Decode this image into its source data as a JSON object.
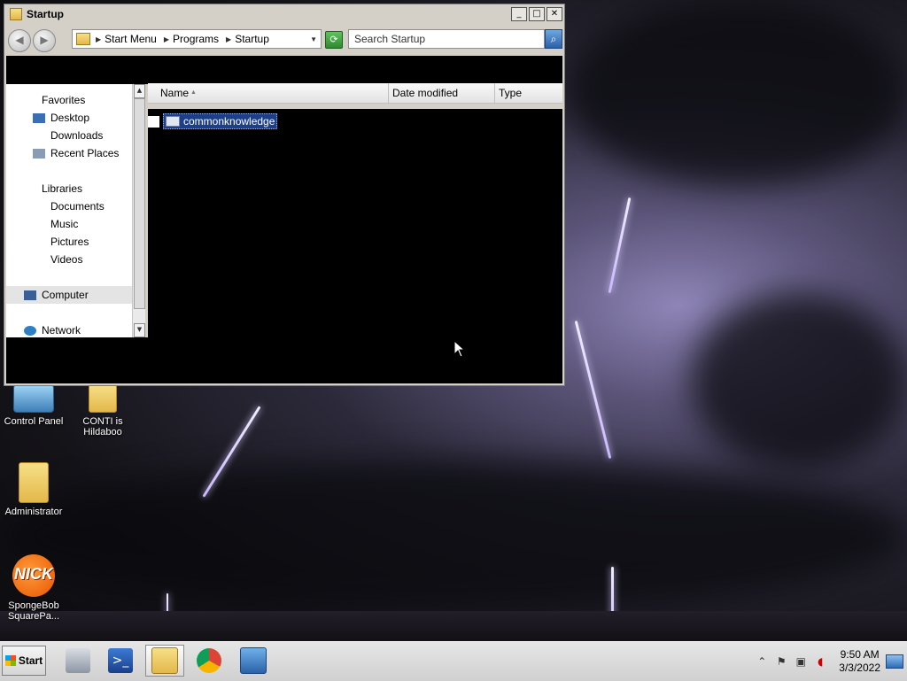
{
  "window": {
    "title": "Startup",
    "controls": {
      "minimize": "_",
      "maximize": "□",
      "close": "✕"
    }
  },
  "address": {
    "breadcrumbs": [
      "Start Menu",
      "Programs",
      "Startup"
    ],
    "search_placeholder": "Search Startup"
  },
  "nav_pane": {
    "favorites_header": "Favorites",
    "favorites": [
      "Desktop",
      "Downloads",
      "Recent Places"
    ],
    "libraries_header": "Libraries",
    "libraries": [
      "Documents",
      "Music",
      "Pictures",
      "Videos"
    ],
    "computer": "Computer",
    "network": "Network"
  },
  "columns": {
    "name": "Name",
    "date": "Date modified",
    "type": "Type"
  },
  "files": [
    {
      "name": "commonknowledge"
    }
  ],
  "desktop_icons": {
    "control_panel": "Control Panel",
    "conti": "CONTI is Hildaboo",
    "administrator": "Administrator",
    "nick_line1": "SpongeBob",
    "nick_line2": "SquarePa...",
    "nick_logo": "NICK"
  },
  "taskbar": {
    "start_label": "Start",
    "clock_time": "9:50 AM",
    "clock_date": "3/3/2022"
  },
  "icons": [
    "folder-icon",
    "back-icon",
    "forward-icon",
    "refresh-icon",
    "search-icon",
    "desktop-icon",
    "downloads-icon",
    "recent-places-icon",
    "computer-icon",
    "network-icon",
    "file-icon",
    "start-icon",
    "server-manager-icon",
    "powershell-icon",
    "explorer-icon",
    "chrome-icon",
    "remote-desktop-icon",
    "flag-icon",
    "network-tray-icon",
    "volume-muted-icon",
    "show-desktop-icon"
  ]
}
